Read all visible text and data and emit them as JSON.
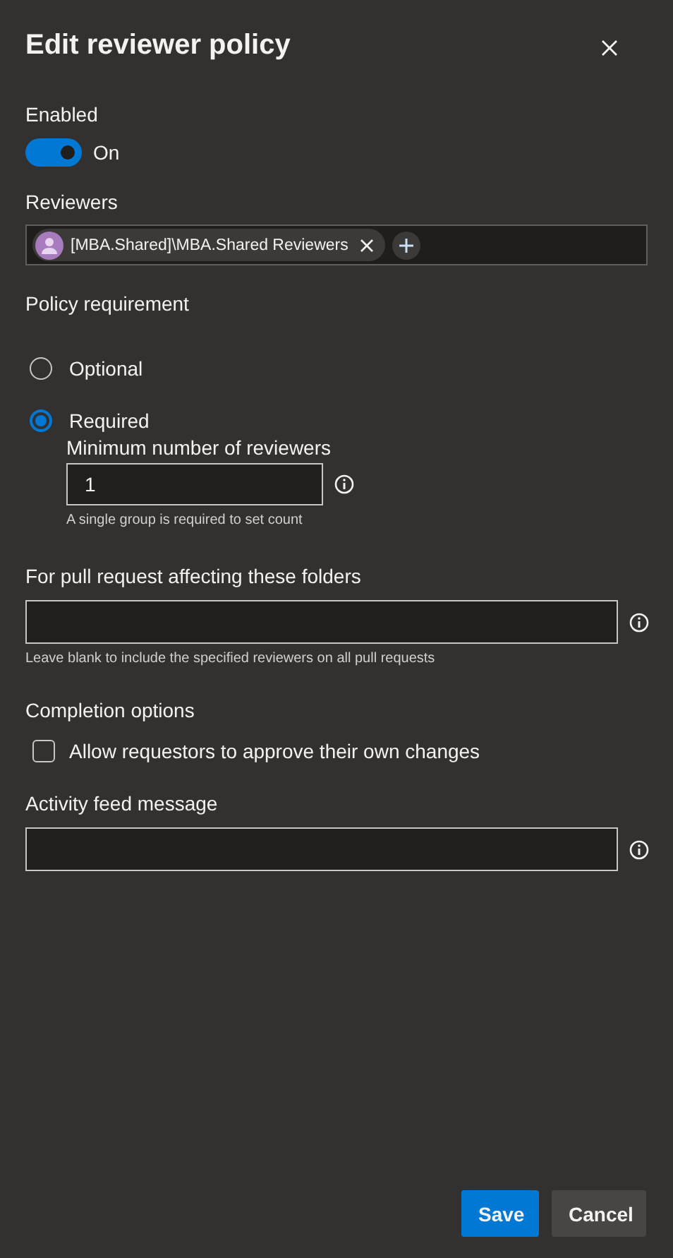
{
  "title": "Edit reviewer policy",
  "enabled": {
    "label": "Enabled",
    "on": true,
    "state_text": "On"
  },
  "reviewers": {
    "label": "Reviewers",
    "chips": [
      {
        "text": "[MBA.Shared]\\MBA.Shared Reviewers"
      }
    ]
  },
  "policy_requirement": {
    "label": "Policy requirement",
    "options": [
      {
        "label": "Optional",
        "selected": false
      },
      {
        "label": "Required",
        "selected": true
      }
    ],
    "minimum": {
      "label": "Minimum number of reviewers",
      "value": "1",
      "hint": "A single group is required to set count"
    }
  },
  "folders": {
    "label": "For pull request affecting these folders",
    "hint": "Leave blank to include the specified reviewers on all pull requests"
  },
  "completion": {
    "label": "Completion options",
    "checkbox": {
      "label": "Allow requestors to approve their own changes",
      "checked": false
    }
  },
  "activity": {
    "label": "Activity feed message"
  },
  "buttons": [
    {
      "label": "Save",
      "kind": "primary"
    },
    {
      "label": "Cancel",
      "kind": "secondary"
    }
  ]
}
